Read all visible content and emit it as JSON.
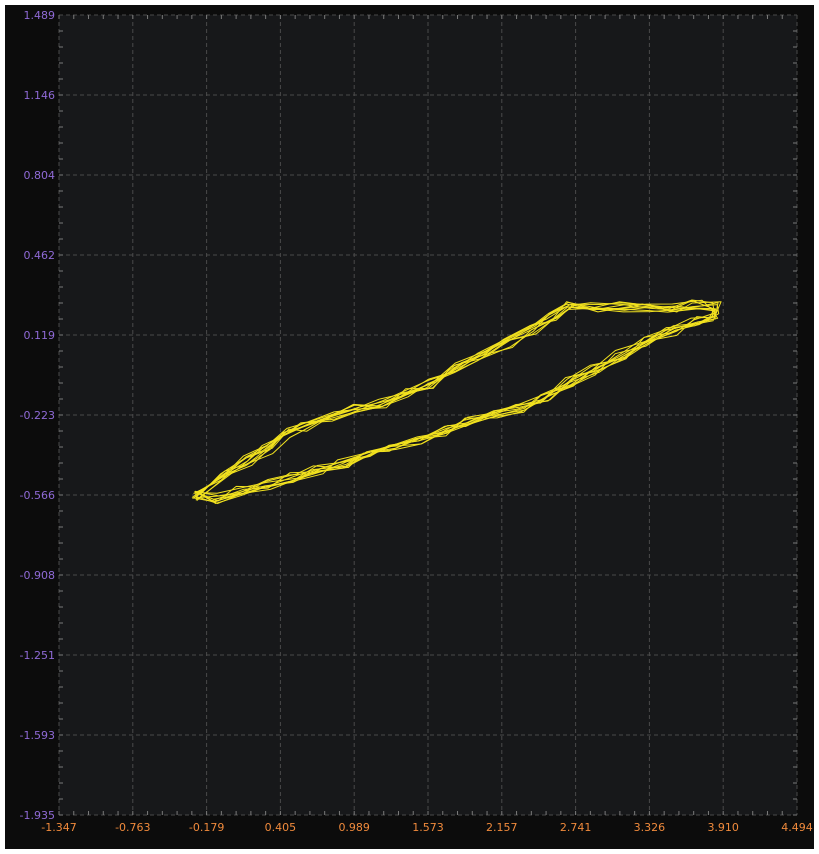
{
  "colors": {
    "background": "#0c0c0c",
    "plot_area": "#17181a",
    "grid": "#4a4a4a",
    "trace": "#f2e21f",
    "y_tick_label": "#8f6ad6",
    "x_tick_label": "#f08a3c"
  },
  "chart_data": {
    "type": "line",
    "title": "",
    "xlabel": "",
    "ylabel": "",
    "xlim": [
      -1.347,
      4.494
    ],
    "ylim": [
      -1.935,
      1.489
    ],
    "grid": true,
    "legend": "none",
    "x_ticks": [
      "-1.347",
      "-0.763",
      "-0.179",
      "0.405",
      "0.989",
      "1.573",
      "2.157",
      "2.741",
      "3.326",
      "3.910",
      "4.494"
    ],
    "y_ticks": [
      "-1.935",
      "-1.593",
      "-1.251",
      "-0.908",
      "-0.566",
      "-0.223",
      "0.119",
      "0.462",
      "0.804",
      "1.146",
      "1.489"
    ],
    "series": [
      {
        "style": "repeated closed loop (upper and lower branch, ~10 overlapping cycles)",
        "loop_outline": {
          "x": [
            -0.25,
            -0.05,
            0.15,
            0.3,
            0.45,
            0.6,
            0.8,
            1.0,
            1.2,
            1.4,
            1.6,
            1.8,
            2.0,
            2.2,
            2.4,
            2.55,
            2.7,
            2.9,
            3.1,
            3.3,
            3.5,
            3.7,
            3.85,
            3.85,
            3.7,
            3.5,
            3.3,
            3.1,
            2.9,
            2.7,
            2.5,
            2.3,
            2.1,
            1.9,
            1.7,
            1.5,
            1.3,
            1.1,
            0.9,
            0.7,
            0.5,
            0.3,
            0.1,
            -0.1,
            -0.25
          ],
          "y": [
            -0.57,
            -0.48,
            -0.42,
            -0.37,
            -0.3,
            -0.27,
            -0.23,
            -0.2,
            -0.17,
            -0.13,
            -0.09,
            -0.02,
            0.03,
            0.08,
            0.14,
            0.2,
            0.24,
            0.24,
            0.24,
            0.24,
            0.24,
            0.25,
            0.24,
            0.2,
            0.18,
            0.14,
            0.09,
            0.04,
            -0.03,
            -0.08,
            -0.15,
            -0.19,
            -0.22,
            -0.25,
            -0.29,
            -0.33,
            -0.37,
            -0.4,
            -0.43,
            -0.46,
            -0.49,
            -0.52,
            -0.55,
            -0.58,
            -0.57
          ]
        }
      }
    ]
  }
}
